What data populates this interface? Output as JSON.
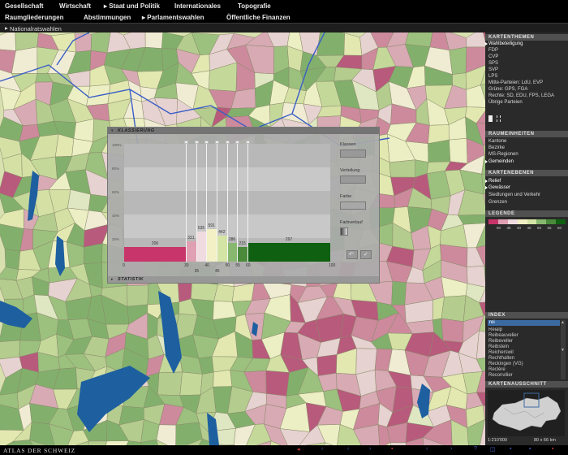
{
  "menu": {
    "row1": [
      "Gesellschaft",
      "Wirtschaft",
      "Staat und Politik",
      "Internationales",
      "Topografie"
    ],
    "row2": [
      "Raumgliederungen",
      "Abstimmungen",
      "Parlamentswahlen",
      "Öffentliche Finanzen"
    ]
  },
  "breadcrumb": "Nationalratswahlen",
  "panel": {
    "kartenthemen_title": "KARTENTHEMEN",
    "themes": [
      "Wahlbeteiligung",
      "FDP",
      "CVP",
      "SPS",
      "SVP",
      "LPS",
      "Mitte-Parteien: LdU, EVP",
      "Grüne: GPS, FGA",
      "Rechte: SD, EDU, FPS, LEGA",
      "Übrige Parteien"
    ],
    "raumeinheiten_title": "RAUMEINHEITEN",
    "units": [
      "Kantone",
      "Bezirke",
      "MS-Regionen",
      "Gemeinden"
    ],
    "kartenebenen_title": "KARTENEBENEN",
    "layers": [
      "Relief",
      "Gewässer",
      "Siedlungen und Verkehr",
      "Grenzen"
    ],
    "legende_title": "LEGENDE",
    "legend_labels": [
      "50",
      "35",
      "40",
      "45",
      "50",
      "55",
      "60"
    ],
    "index_title": "INDEX",
    "index_query": "rei",
    "index_items": [
      "Reialp",
      "Reibeauvelier",
      "Reibeveller",
      "Reibstein",
      "Reicherswil",
      "Rechthalten",
      "Reckingen (VG)",
      "Reclère",
      "Reconvilier"
    ],
    "kartenausschnitt_title": "KARTENAUSSCHNITT",
    "scale": "1:210'000",
    "extent": "80 x 66 km"
  },
  "dialog": {
    "title": "KLASSIERUNG",
    "footer": "STATISTIK",
    "controls": {
      "klassen": "Klassen",
      "verteilung": "Verteilung",
      "farbe": "Farbe",
      "farbverlauf": "Farbverlauf"
    }
  },
  "chart_data": {
    "type": "bar",
    "title": "KLASSIERUNG",
    "ylabel": "",
    "y_ticks": [
      "100%",
      "80%",
      "60%",
      "40%",
      "20%"
    ],
    "x_ticks_top": [
      "0",
      "30",
      "40",
      "50",
      "55",
      "60",
      "100"
    ],
    "x_ticks_bottom": [
      "35",
      "45"
    ],
    "xlim": [
      0,
      100
    ],
    "classes": [
      {
        "from": 0,
        "to": 30,
        "count": 206,
        "color": "#c8356a"
      },
      {
        "from": 30,
        "to": 35,
        "count": 331,
        "color": "#e0a0b4"
      },
      {
        "from": 35,
        "to": 40,
        "count": 535,
        "color": "#f0dce0"
      },
      {
        "from": 40,
        "to": 45,
        "count": 591,
        "color": "#f2f0c4"
      },
      {
        "from": 45,
        "to": 50,
        "count": 442,
        "color": "#d4e4a4"
      },
      {
        "from": 50,
        "to": 55,
        "count": 286,
        "color": "#88b870"
      },
      {
        "from": 55,
        "to": 60,
        "count": 215,
        "color": "#4a8a3a"
      },
      {
        "from": 60,
        "to": 100,
        "count": 297,
        "color": "#0f6010"
      }
    ]
  },
  "status": {
    "brand": "ATLAS DER SCHWEIZ"
  },
  "colors": {
    "lake": "#1e5fa0",
    "river": "#3a5ec8",
    "pink": "#c8356a",
    "green": "#0f6010"
  }
}
